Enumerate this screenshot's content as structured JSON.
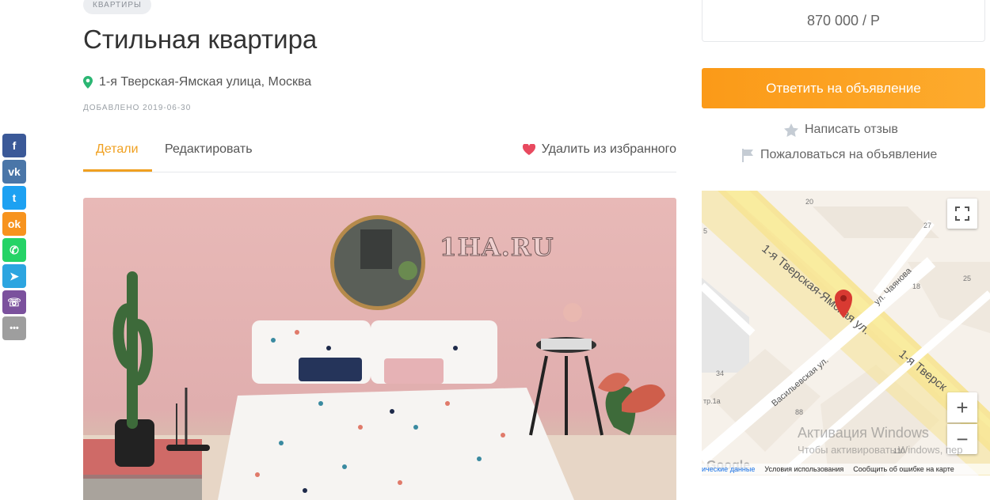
{
  "category": "КВАРТИРЫ",
  "title": "Стильная квартира",
  "address": "1-я Тверская-Ямская улица, Москва",
  "added": "ДОБАВЛЕНО 2019-06-30",
  "tabs": [
    {
      "label": "Детали",
      "active": true
    },
    {
      "label": "Редактировать",
      "active": false
    }
  ],
  "favorite_label": "Удалить из избранного",
  "watermark": "1HA.RU",
  "price": "870 000 / Р",
  "reply_button": "Ответить на объявление",
  "review_link": "Написать отзыв",
  "report_link": "Пожаловаться на объявление",
  "share": [
    {
      "icon": "facebook-icon",
      "color": "#3b5998",
      "glyph": "f"
    },
    {
      "icon": "vk-icon",
      "color": "#4a76a8",
      "glyph": "vk"
    },
    {
      "icon": "twitter-icon",
      "color": "#1da1f2",
      "glyph": "t"
    },
    {
      "icon": "odnoklassniki-icon",
      "color": "#f7931e",
      "glyph": "ok"
    },
    {
      "icon": "whatsapp-icon",
      "color": "#25d366",
      "glyph": "✆"
    },
    {
      "icon": "telegram-icon",
      "color": "#2ca5e0",
      "glyph": "➤"
    },
    {
      "icon": "viber-icon",
      "color": "#7b519d",
      "glyph": "☏"
    },
    {
      "icon": "more-icon",
      "color": "#9e9e9e",
      "glyph": "•••"
    }
  ],
  "map": {
    "street_main": "1-я Тверская-Ямская ул.",
    "street_main_2": "1-я Тверск",
    "street_chayanova": "ул. Чаянова",
    "street_vasilievskaya": "Васильевская ул.",
    "house_numbers": [
      "20",
      "27",
      "5",
      "25",
      "18",
      "34",
      "88",
      "110",
      "тр.1а"
    ],
    "footer": [
      "ические данные",
      "Условия использования",
      "Сообщить об ошибке на карте"
    ],
    "google": "Google",
    "zoom_in": "+",
    "zoom_out": "−"
  },
  "windows_activation": {
    "title": "Активация Windows",
    "subtitle": "Чтобы активировать Windows, пер"
  },
  "colors": {
    "accent": "#f0a020",
    "button": "#fb9a18",
    "pin": "#2bb673",
    "heart": "#e84a5f"
  }
}
